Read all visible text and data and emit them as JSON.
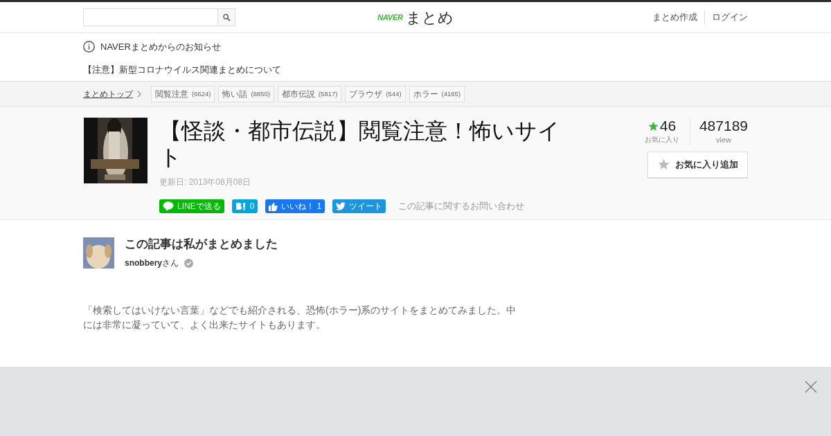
{
  "header": {
    "logo": {
      "brand": "NAVER",
      "name": "まとめ"
    },
    "links": [
      "まとめ作成",
      "ログイン"
    ]
  },
  "notice": {
    "title": "NAVERまとめからのお知らせ",
    "items": [
      "【注意】新型コロナウイルス関連まとめについて"
    ]
  },
  "breadcrumb": {
    "top": "まとめトップ",
    "tags": [
      {
        "label": "閲覧注意",
        "count": "(6624)"
      },
      {
        "label": "怖い話",
        "count": "(8850)"
      },
      {
        "label": "都市伝説",
        "count": "(5817)"
      },
      {
        "label": "ブラウザ",
        "count": "(544)"
      },
      {
        "label": "ホラー",
        "count": "(4165)"
      }
    ]
  },
  "article": {
    "title": "【怪談・都市伝説】閲覧注意！怖いサイト",
    "updated": "更新日: 2013年08月08日",
    "share": [
      {
        "kind": "line",
        "label": "LINEで送る"
      },
      {
        "kind": "hatena",
        "label": "0"
      },
      {
        "kind": "like",
        "label": "いいね！ 1"
      },
      {
        "kind": "tweet",
        "label": "ツイート"
      }
    ],
    "contact": "この記事に関するお問い合わせ",
    "favorites": {
      "count": "46",
      "label": "お気に入り"
    },
    "views": {
      "count": "487189",
      "label": "view"
    },
    "favorite_button": "お気に入り追加"
  },
  "author": {
    "heading": "この記事は私がまとめました",
    "name": "snobbery",
    "suffix": "さん",
    "verified": true
  },
  "intro": "「検索してはいけない言葉」などでも紹介される、恐怖(ホラー)系のサイトをまとめてみました。中には非常に凝っていて、よく出来たサイトもあります。"
}
